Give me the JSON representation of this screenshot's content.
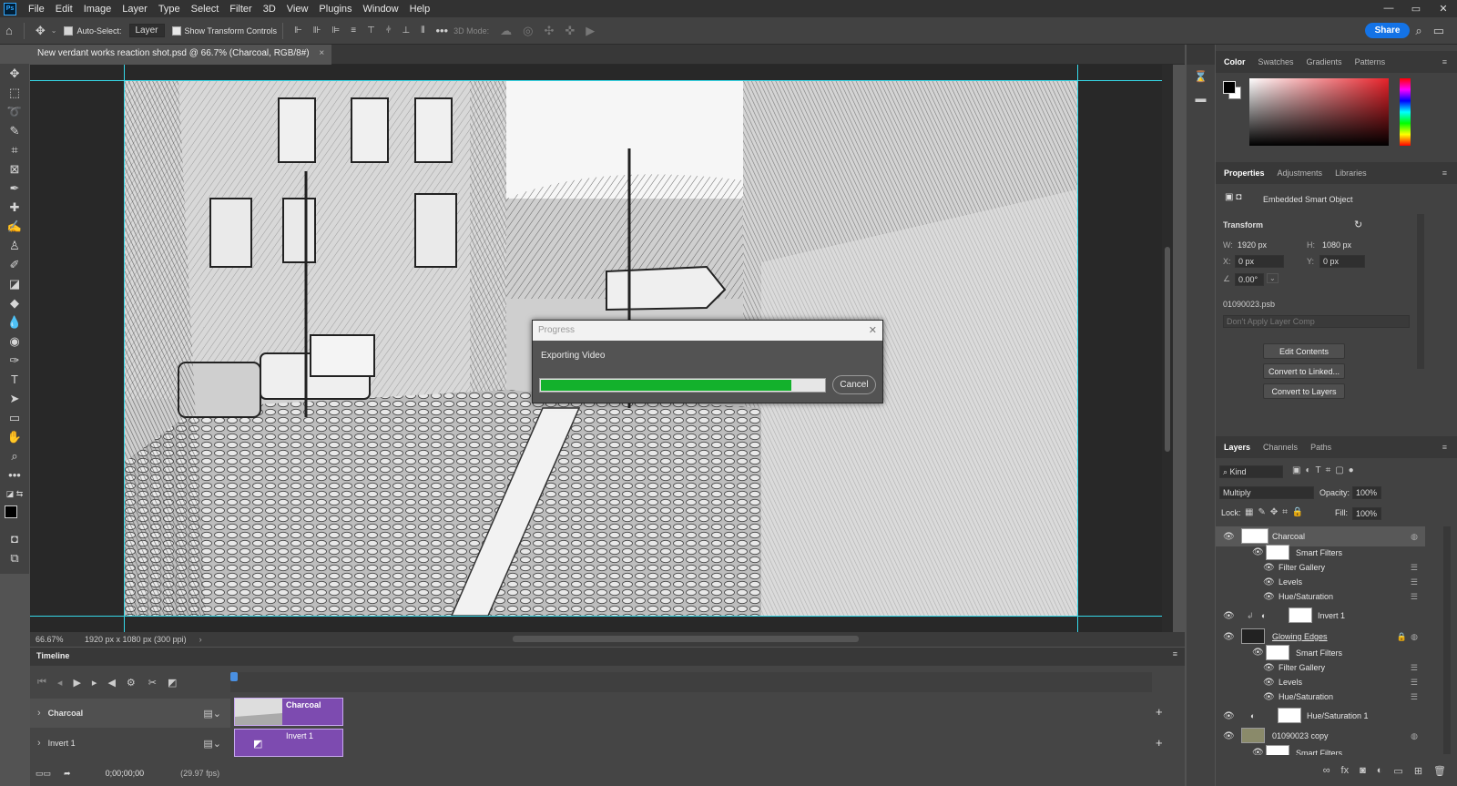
{
  "menubar": {
    "logo": "Ps",
    "items": [
      "File",
      "Edit",
      "Image",
      "Layer",
      "Type",
      "Select",
      "Filter",
      "3D",
      "View",
      "Plugins",
      "Window",
      "Help"
    ],
    "window_controls": [
      "—",
      "▭",
      "✕"
    ]
  },
  "options": {
    "auto_select_label": "Auto-Select:",
    "auto_select_target": "Layer",
    "transform_controls_label": "Show Transform Controls",
    "mode_3d_label": "3D Mode:",
    "share_label": "Share"
  },
  "document": {
    "tab_title": "New verdant works reaction shot.psd @ 66.7% (Charcoal, RGB/8#)",
    "zoom": "66.67%",
    "size_info": "1920 px x 1080 px (300 ppi)"
  },
  "dialog": {
    "title": "Progress",
    "message": "Exporting Video",
    "progress": 0.88,
    "cancel_label": "Cancel"
  },
  "timeline": {
    "title": "Timeline",
    "tracks": [
      {
        "name": "Charcoal",
        "clip": "Charcoal"
      },
      {
        "name": "Invert 1",
        "clip": "Invert 1"
      }
    ],
    "timecode": "0;00;00;00",
    "fps": "(29.97 fps)"
  },
  "color_panel": {
    "tabs": [
      "Color",
      "Swatches",
      "Gradients",
      "Patterns"
    ]
  },
  "properties": {
    "tabs": [
      "Properties",
      "Adjustments",
      "Libraries"
    ],
    "object_type": "Embedded Smart Object",
    "transform_label": "Transform",
    "w": "1920 px",
    "h": "1080 px",
    "x": "0 px",
    "y": "0 px",
    "angle": "0.00°",
    "linked_file": "01090023.psb",
    "layer_comp": "Don't Apply Layer Comp",
    "buttons": [
      "Edit Contents",
      "Convert to Linked...",
      "Convert to Layers"
    ]
  },
  "layers_panel": {
    "tabs": [
      "Layers",
      "Channels",
      "Paths"
    ],
    "kind_label": "Kind",
    "blend_mode": "Multiply",
    "opacity_label": "Opacity:",
    "opacity": "100%",
    "lock_label": "Lock:",
    "fill_label": "Fill:",
    "fill": "100%",
    "layers": [
      {
        "name": "Charcoal",
        "type": "smart"
      },
      {
        "name": "Smart Filters",
        "type": "filters"
      },
      {
        "name": "Filter Gallery",
        "type": "filter"
      },
      {
        "name": "Levels",
        "type": "filter"
      },
      {
        "name": "Hue/Saturation",
        "type": "filter"
      },
      {
        "name": "Invert 1",
        "type": "adjustment"
      },
      {
        "name": "Glowing Edges",
        "type": "smart"
      },
      {
        "name": "Smart Filters",
        "type": "filters"
      },
      {
        "name": "Filter Gallery",
        "type": "filter"
      },
      {
        "name": "Levels",
        "type": "filter"
      },
      {
        "name": "Hue/Saturation",
        "type": "filter"
      },
      {
        "name": "Hue/Saturation 1",
        "type": "adjustment"
      },
      {
        "name": "01090023 copy",
        "type": "smart"
      },
      {
        "name": "Smart Filters",
        "type": "filters"
      }
    ]
  }
}
